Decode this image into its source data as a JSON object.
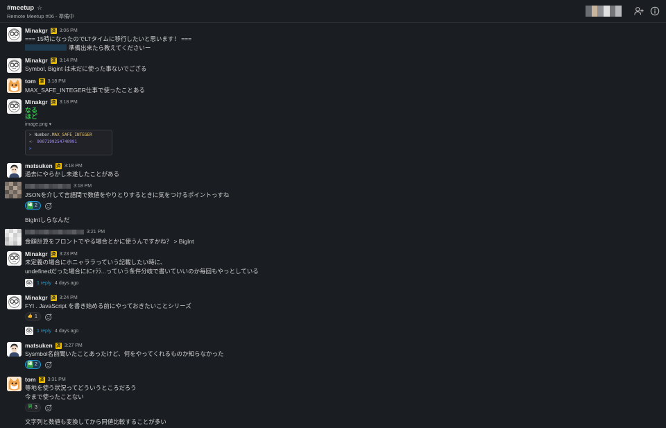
{
  "channel": {
    "name": "#meetup",
    "topic": "Remote Meetup #06 - 準備中"
  },
  "colors": {
    "background": "#1a1d21",
    "link": "#1d9bd1",
    "badge": "#f2c200",
    "naruhodo": "#31c04a"
  },
  "header_icons": [
    "star-icon",
    "add-member-icon",
    "info-icon"
  ],
  "messages": [
    {
      "user": "Minakgr",
      "badge": "済",
      "time": "3:06 PM",
      "lines": [
        "=== 15時になったのでLTタイムに移行したいと思います！ ===",
        "準備出来たら教えてくださいー"
      ]
    },
    {
      "user": "Minakgr",
      "badge": "済",
      "time": "3:14 PM",
      "lines": [
        "Symbol, Bigint は未だに使った事ないでござる"
      ]
    },
    {
      "user": "tom",
      "badge": "済",
      "time": "3:18 PM",
      "lines": [
        "MAX_SAFE_INTEGER仕事で使ったことある"
      ]
    },
    {
      "user": "Minakgr",
      "badge": "済",
      "time": "3:18 PM",
      "emoji_text": [
        "なる",
        "ほど"
      ],
      "file_name": "image.png",
      "console": {
        "input_prefix": ">",
        "input_object": "Number.",
        "input_prop": "MAX_SAFE_INTEGER",
        "output_prefix": "<·",
        "output": "9007199254740991",
        "prompt": ">"
      }
    },
    {
      "user": "matsuken",
      "badge": "済",
      "time": "3:18 PM",
      "lines": [
        "過去にやらかし未遂したことがある"
      ]
    },
    {
      "user": "",
      "time": "3:18 PM",
      "lines": [
        "JSONを介して言語間で数値をやりとりするときに気をつけるポイントっすね"
      ],
      "reactions": [
        {
          "emoji": "確",
          "count": "2"
        }
      ]
    },
    {
      "user": "",
      "lines": [
        "BigIntしらなんだ"
      ]
    },
    {
      "user": "",
      "time": "3:21 PM",
      "lines": [
        "金額計算をフロントでやる場合とかに使うんですかね？ > BigInt"
      ]
    },
    {
      "user": "Minakgr",
      "badge": "済",
      "time": "3:23 PM",
      "lines": [
        "未定義の場合にホニャララっていう記載したい時に、",
        "undefinedだった場合にﾎﾆｬﾗﾗ...っていう条件分岐で書いていいのか毎回もやっとしている"
      ],
      "thread": {
        "replies": "1 reply",
        "ago": "4 days ago"
      }
    },
    {
      "user": "Minakgr",
      "badge": "済",
      "time": "3:24 PM",
      "lines": [
        "FYI . JavaScript を書き始める前にやっておきたいことシリーズ"
      ],
      "reactions": [
        {
          "emoji": "👍",
          "count": "1"
        }
      ],
      "thread": {
        "replies": "1 reply",
        "ago": "4 days ago"
      }
    },
    {
      "user": "matsuken",
      "badge": "済",
      "time": "3:27 PM",
      "lines": [
        "Sysmbol名前聞いたことあったけど、何をやってくれるものか知らなかった"
      ],
      "reactions": [
        {
          "emoji": "確",
          "count": "2"
        }
      ]
    },
    {
      "user": "tom",
      "badge": "済",
      "time": "3:31 PM",
      "lines": [
        "等地を使う状況ってどういうところだろう",
        "今まで使ったことない"
      ],
      "reactions": [
        {
          "emoji": "同",
          "count": "3"
        }
      ]
    },
    {
      "user": "",
      "lines": [
        "文字列と数値も変換してから同値比較することが多い"
      ]
    }
  ]
}
